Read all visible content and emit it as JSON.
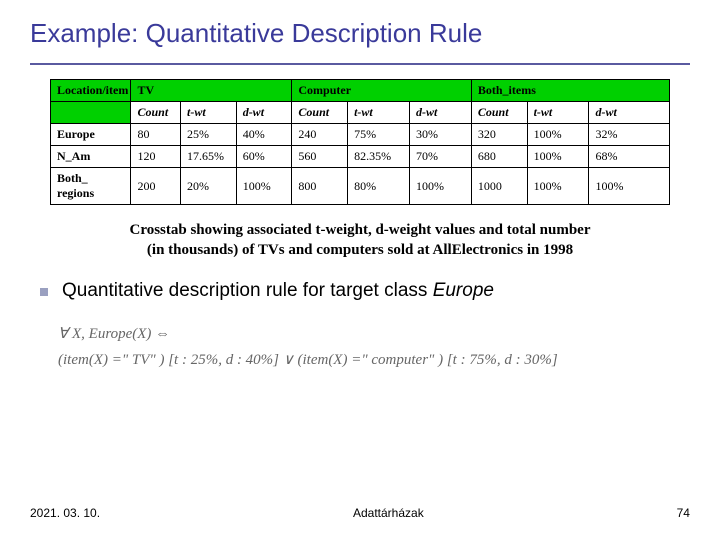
{
  "title": "Example: Quantitative Description Rule",
  "chart_data": {
    "type": "table",
    "column_groups": [
      "Location/item",
      "TV",
      "Computer",
      "Both_items"
    ],
    "sub_columns": [
      "Count",
      "t-wt",
      "d-wt"
    ],
    "rows": [
      {
        "label": "Europe",
        "tv": {
          "count": "80",
          "t": "25%",
          "d": "40%"
        },
        "comp": {
          "count": "240",
          "t": "75%",
          "d": "30%"
        },
        "both": {
          "count": "320",
          "t": "100%",
          "d": "32%"
        }
      },
      {
        "label": "N_Am",
        "tv": {
          "count": "120",
          "t": "17.65%",
          "d": "60%"
        },
        "comp": {
          "count": "560",
          "t": "82.35%",
          "d": "70%"
        },
        "both": {
          "count": "680",
          "t": "100%",
          "d": "68%"
        }
      },
      {
        "label": "Both_ regions",
        "tv": {
          "count": "200",
          "t": "20%",
          "d": "100%"
        },
        "comp": {
          "count": "800",
          "t": "80%",
          "d": "100%"
        },
        "both": {
          "count": "1000",
          "t": "100%",
          "d": "100%"
        }
      }
    ]
  },
  "caption_l1": "Crosstab showing associated t-weight, d-weight values and total number",
  "caption_l2": "(in thousands) of TVs and computers sold at AllElectronics in 1998",
  "bullet_text": "Quantitative description rule for target class ",
  "bullet_tail": "Europe",
  "eq_line1": "∀ X, Europe(X) ⇔",
  "eq_line2": "(item(X) =\" TV\" ) [t : 25%, d : 40%] ∨ (item(X) =\" computer\" ) [t : 75%, d : 30%]",
  "footer": {
    "left": "2021. 03. 10.",
    "center": "Adattárházak",
    "right": "74"
  }
}
